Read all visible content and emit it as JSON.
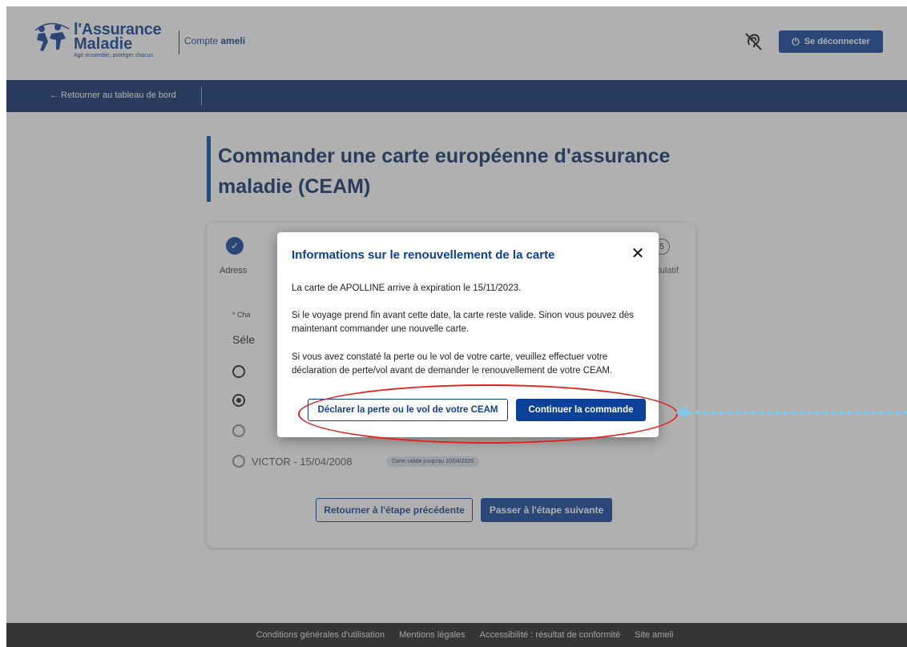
{
  "header": {
    "brand_line1": "l'Assurance",
    "brand_line2": "Maladie",
    "tagline": "Agir ensemble, protéger chacun",
    "compte_prefix": "Compte",
    "compte_name": "ameli",
    "logout_label": "Se déconnecter"
  },
  "nav": {
    "back_label": "← Retourner au tableau de bord"
  },
  "main": {
    "title": "Commander une carte européenne d'assurance maladie (CEAM)",
    "stepper": {
      "step1_label": "Adress",
      "step5_number": "5",
      "step5_label": "apitulatif"
    },
    "required_note": "* Cha",
    "select_prompt": "Séle",
    "beneficiaries": [
      {
        "label": "",
        "selected": false
      },
      {
        "label": "",
        "selected": true
      },
      {
        "label": "",
        "selected": false,
        "badge": ""
      },
      {
        "label": "VICTOR - 15/04/2008",
        "selected": false,
        "badge": "Carte valide jusqu'au 10/04/2025"
      }
    ],
    "prev_button": "Retourner à l'étape précédente",
    "next_button": "Passer à l'étape suivante"
  },
  "modal": {
    "title": "Informations sur le renouvellement de la carte",
    "p1": "La carte de APOLLINE arrive à expiration le 15/11/2023.",
    "p2": "Si le voyage prend fin avant cette date, la carte reste valide. Sinon vous pouvez dès maintenant commander une nouvelle carte.",
    "p3": "Si vous avez constaté la perte ou le vol de votre carte, veuillez effectuer votre déclaration de perte/vol avant de demander le renouvellement de votre CEAM.",
    "declare_button": "Déclarer la perte ou le vol de votre CEAM",
    "continue_button": "Continuer la commande"
  },
  "footer": {
    "links": [
      "Conditions générales d'utilisation",
      "Mentions légales",
      "Accessibilité : résultat de conformité",
      "Site ameli"
    ]
  },
  "colors": {
    "brand_blue": "#0c419a",
    "nav_band": "#0c2d6b",
    "annotation_red": "#e81f1f",
    "annotation_arrow": "#7ec8ee"
  },
  "icons": [
    "hearing-impaired-icon",
    "power-icon",
    "close-icon",
    "check-icon",
    "back-arrow-icon"
  ]
}
